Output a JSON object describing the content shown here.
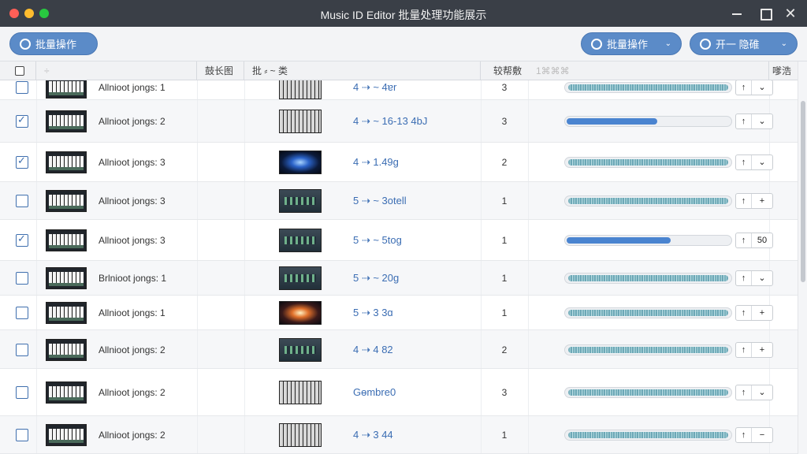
{
  "window": {
    "title": "Music ID Editor 批量处理功能展示",
    "close_glyph": "✕"
  },
  "toolbar": {
    "left_button": "批量操作",
    "middle_button": "批量操作",
    "right_button": "开一 隐碓",
    "chevron": "⌄"
  },
  "table": {
    "headers": {
      "thumb": "÷",
      "col3": "鼓长图",
      "col4": "批 ⸗ ~ 类",
      "col5": "较帮敷",
      "col6": "1⌘⌘⌘",
      "col7": "嗲浩"
    },
    "rows": [
      {
        "checked": false,
        "name": "Allnioot jongs: 1",
        "image": "keys",
        "info": "4 ⇢ ~ 4ɐr",
        "count": "3",
        "mode": "wave",
        "progress": 0,
        "step_a": "↑",
        "step_b": "⌄"
      },
      {
        "checked": true,
        "name": "Allnioot jongs: 2",
        "image": "keys",
        "info": "4 ⇢ ~ 16-13 4bJ",
        "count": "3",
        "mode": "progress",
        "progress": 0.55,
        "step_a": "↑",
        "step_b": "⌄"
      },
      {
        "checked": true,
        "name": "Allnioot jongs: 3",
        "image": "glow-blue",
        "info": "4 ⇢ 1.49g",
        "count": "2",
        "mode": "wave",
        "progress": 0,
        "step_a": "↑",
        "step_b": "⌄"
      },
      {
        "checked": false,
        "name": "Allnioot jongs: 3",
        "image": "panel",
        "info": "5 ⇢ ~ 3otell",
        "count": "1",
        "mode": "wave",
        "progress": 0,
        "step_a": "↑",
        "step_b": "+"
      },
      {
        "checked": true,
        "name": "Allnioot jongs: 3",
        "image": "panel",
        "info": "5 ⇢ ~ 5tog",
        "count": "1",
        "mode": "progress",
        "progress": 0.63,
        "step_a": "↑",
        "step_b": "50"
      },
      {
        "checked": false,
        "name": "Brlnioot jongs: 1",
        "image": "panel",
        "info": "5 ⇢ ~ 20g",
        "count": "1",
        "mode": "wave",
        "progress": 0,
        "step_a": "↑",
        "step_b": "⌄"
      },
      {
        "checked": false,
        "name": "Allnioot jongs: 1",
        "image": "glow-orange",
        "info": "5 ⇢ 3 3ɑ",
        "count": "1",
        "mode": "wave",
        "progress": 0,
        "step_a": "↑",
        "step_b": "+"
      },
      {
        "checked": false,
        "name": "Allnioot jongs: 2",
        "image": "panel",
        "info": "4 ⇢ 4 82",
        "count": "2",
        "mode": "wave",
        "progress": 0,
        "step_a": "↑",
        "step_b": "+"
      },
      {
        "checked": false,
        "name": "Allnioot jongs: 2",
        "image": "keys",
        "info": "Gɵmbre0",
        "count": "3",
        "mode": "wave",
        "progress": 0,
        "step_a": "↑",
        "step_b": "⌄"
      },
      {
        "checked": false,
        "name": "Allnioot jongs: 2",
        "image": "keys",
        "info": "4 ⇢ 3 44",
        "count": "1",
        "mode": "wave",
        "progress": 0,
        "step_a": "↑",
        "step_b": "−"
      }
    ]
  },
  "colors": {
    "accent": "#5b8bc8",
    "link": "#3b6db3",
    "titlebar": "#3a3f47",
    "wave": "#6aa9b6"
  }
}
